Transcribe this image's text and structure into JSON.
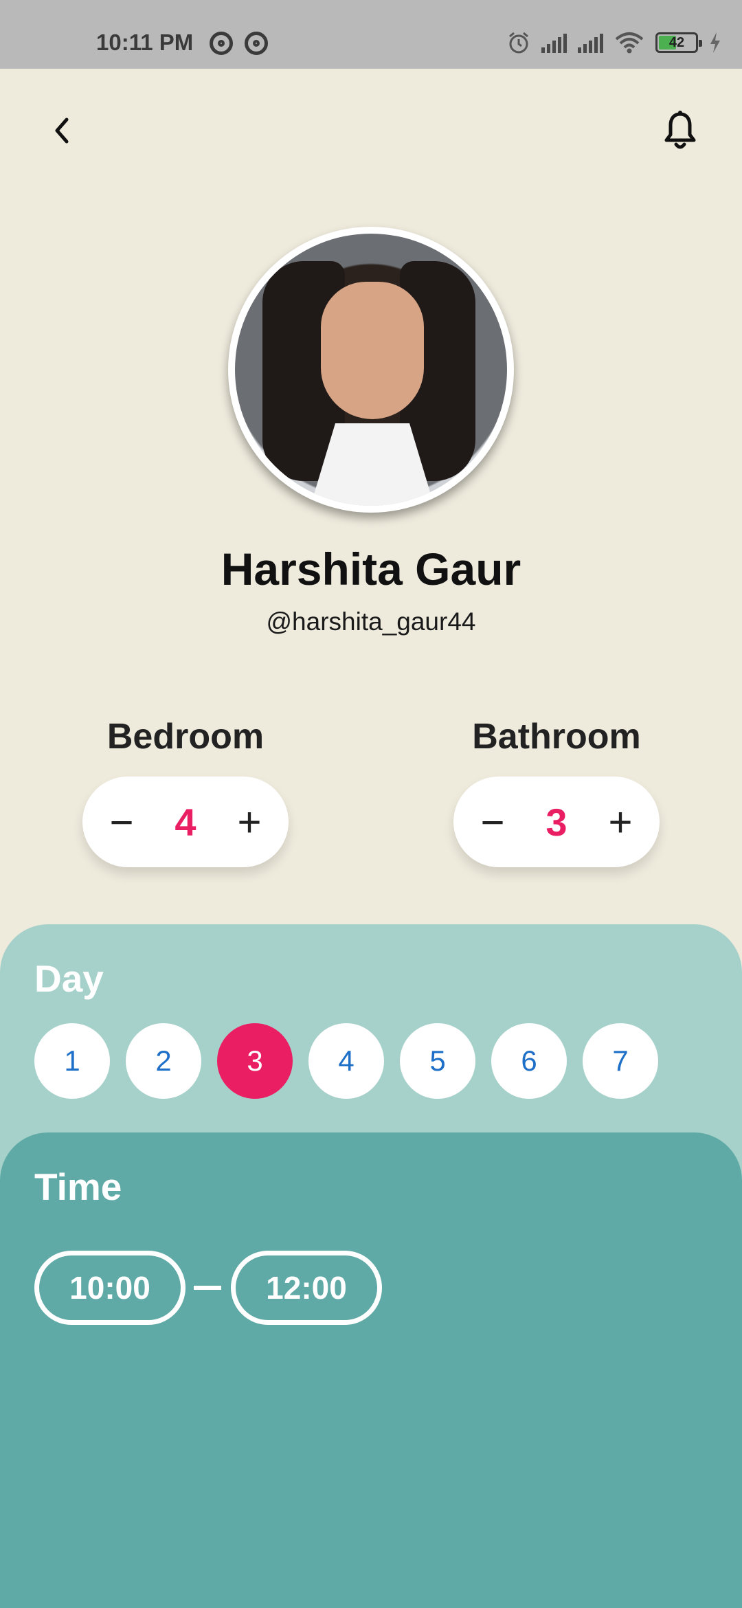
{
  "status_bar": {
    "time": "10:11 PM",
    "battery": "42"
  },
  "header": {
    "back_icon": "chevron-left-icon",
    "bell_icon": "bell-icon"
  },
  "profile": {
    "name": "Harshita Gaur",
    "handle": "@harshita_gaur44"
  },
  "counters": {
    "bedroom": {
      "label": "Bedroom",
      "value": "4",
      "minus": "−",
      "plus": "+"
    },
    "bathroom": {
      "label": "Bathroom",
      "value": "3",
      "minus": "−",
      "plus": "+"
    }
  },
  "day": {
    "title": "Day",
    "options": [
      "1",
      "2",
      "3",
      "4",
      "5",
      "6",
      "7"
    ],
    "selected": "3"
  },
  "time": {
    "title": "Time",
    "start": "10:00",
    "end": "12:00"
  },
  "colors": {
    "accent": "#e91e63",
    "day_panel": "#a6d1ca",
    "time_panel": "#5faaa6",
    "background": "#eeeadc"
  }
}
